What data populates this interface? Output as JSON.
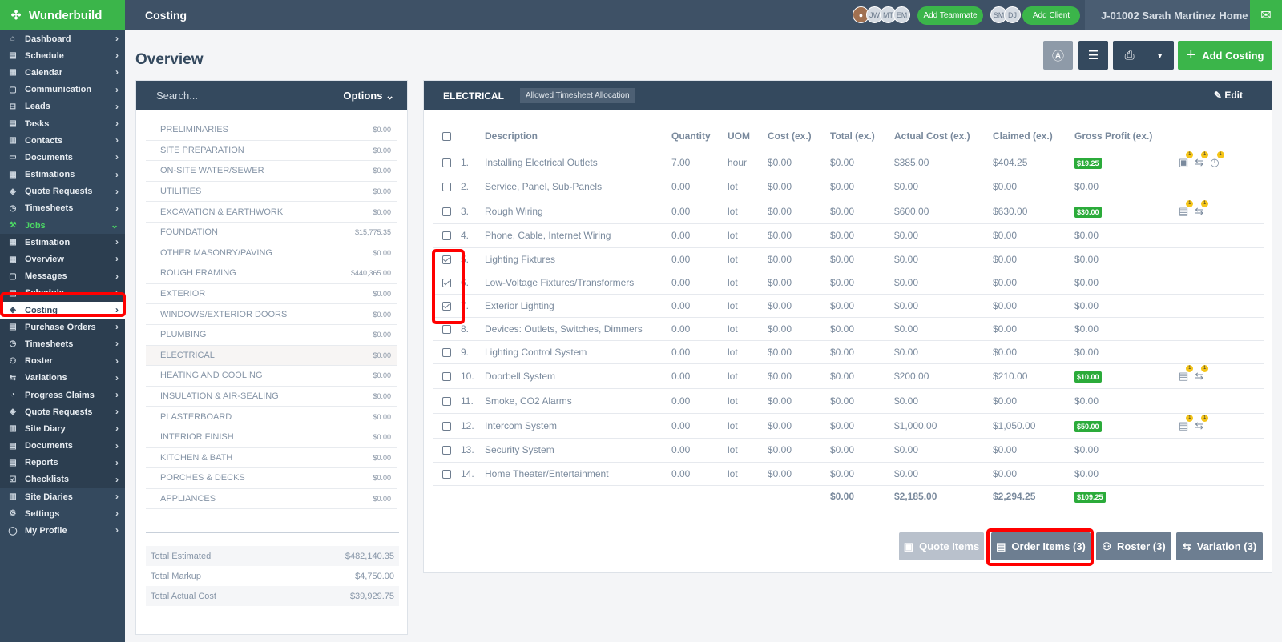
{
  "app": {
    "name": "Wunderbuild"
  },
  "topbar": {
    "title": "Costing",
    "avatars": [
      "JW",
      "MT",
      "EM"
    ],
    "add_teammate": "Add Teammate",
    "client_avatars": [
      "SM",
      "DJ"
    ],
    "add_client": "Add Client",
    "job_name": "J-01002 Sarah Martinez Home"
  },
  "sidebar": {
    "items": [
      {
        "label": "Dashboard",
        "icon": "home-icon"
      },
      {
        "label": "Schedule",
        "icon": "schedule-icon"
      },
      {
        "label": "Calendar",
        "icon": "calendar-icon"
      },
      {
        "label": "Communication",
        "icon": "chat-icon"
      },
      {
        "label": "Leads",
        "icon": "leads-icon"
      },
      {
        "label": "Tasks",
        "icon": "tasks-icon"
      },
      {
        "label": "Contacts",
        "icon": "contacts-icon"
      },
      {
        "label": "Documents",
        "icon": "folder-icon"
      },
      {
        "label": "Estimations",
        "icon": "estimations-icon"
      },
      {
        "label": "Quote Requests",
        "icon": "tag-icon"
      },
      {
        "label": "Timesheets",
        "icon": "clock-icon"
      },
      {
        "label": "Jobs",
        "icon": "hammer-icon"
      }
    ],
    "job_items": [
      {
        "label": "Estimation",
        "icon": "estimation-icon"
      },
      {
        "label": "Overview",
        "icon": "grid-icon"
      },
      {
        "label": "Messages",
        "icon": "message-icon"
      },
      {
        "label": "Schedule",
        "icon": "schedule-icon"
      },
      {
        "label": "Costing",
        "icon": "tag-icon"
      },
      {
        "label": "Purchase Orders",
        "icon": "purchase-icon"
      },
      {
        "label": "Timesheets",
        "icon": "clock-icon"
      },
      {
        "label": "Roster",
        "icon": "people-icon"
      },
      {
        "label": "Variations",
        "icon": "variation-icon"
      },
      {
        "label": "Progress Claims",
        "icon": "claims-icon"
      },
      {
        "label": "Quote Requests",
        "icon": "tag-icon"
      },
      {
        "label": "Site Diary",
        "icon": "diary-icon"
      },
      {
        "label": "Documents",
        "icon": "document-icon"
      },
      {
        "label": "Reports",
        "icon": "reports-icon"
      },
      {
        "label": "Checklists",
        "icon": "checklist-icon"
      }
    ],
    "bottom_items": [
      {
        "label": "Site Diaries",
        "icon": "diary-icon"
      },
      {
        "label": "Settings",
        "icon": "gear-icon"
      },
      {
        "label": "My Profile",
        "icon": "user-icon"
      }
    ]
  },
  "page": {
    "title": "Overview",
    "add_costing": "Add Costing"
  },
  "left_panel": {
    "search_placeholder": "Search...",
    "options_label": "Options",
    "categories": [
      {
        "name": "PRELIMINARIES",
        "amount": "$0.00"
      },
      {
        "name": "SITE PREPARATION",
        "amount": "$0.00"
      },
      {
        "name": "ON-SITE WATER/SEWER",
        "amount": "$0.00"
      },
      {
        "name": "UTILITIES",
        "amount": "$0.00"
      },
      {
        "name": "EXCAVATION & EARTHWORK",
        "amount": "$0.00"
      },
      {
        "name": "FOUNDATION",
        "amount": "$15,775.35"
      },
      {
        "name": "OTHER MASONRY/PAVING",
        "amount": "$0.00"
      },
      {
        "name": "ROUGH FRAMING",
        "amount": "$440,365.00"
      },
      {
        "name": "EXTERIOR",
        "amount": "$0.00"
      },
      {
        "name": "WINDOWS/EXTERIOR DOORS",
        "amount": "$0.00"
      },
      {
        "name": "PLUMBING",
        "amount": "$0.00"
      },
      {
        "name": "ELECTRICAL",
        "amount": "$0.00"
      },
      {
        "name": "HEATING AND COOLING",
        "amount": "$0.00"
      },
      {
        "name": "INSULATION & AIR-SEALING",
        "amount": "$0.00"
      },
      {
        "name": "PLASTERBOARD",
        "amount": "$0.00"
      },
      {
        "name": "INTERIOR FINISH",
        "amount": "$0.00"
      },
      {
        "name": "KITCHEN & BATH",
        "amount": "$0.00"
      },
      {
        "name": "PORCHES & DECKS",
        "amount": "$0.00"
      },
      {
        "name": "APPLIANCES",
        "amount": "$0.00"
      }
    ],
    "totals": [
      {
        "label": "Total Estimated",
        "value": "$482,140.35"
      },
      {
        "label": "Total Markup",
        "value": "$4,750.00"
      },
      {
        "label": "Total Actual Cost",
        "value": "$39,929.75"
      }
    ]
  },
  "section": {
    "name": "ELECTRICAL",
    "tag": "Allowed Timesheet Allocation",
    "edit_label": "Edit",
    "columns": [
      "Description",
      "Quantity",
      "UOM",
      "Cost (ex.)",
      "Total (ex.)",
      "Actual Cost (ex.)",
      "Claimed (ex.)",
      "Gross Profit (ex.)"
    ],
    "rows": [
      {
        "num": "1.",
        "desc": "Installing Electrical Outlets",
        "qty": "7.00",
        "uom": "hour",
        "cost": "$0.00",
        "total": "$0.00",
        "actual": "$385.00",
        "claimed": "$404.25",
        "gp": "$19.25",
        "gp_badge": true,
        "checked": false,
        "icons": [
          "purchase-order-icon",
          "variation-icon",
          "clock-icon"
        ]
      },
      {
        "num": "2.",
        "desc": "Service, Panel, Sub-Panels",
        "qty": "0.00",
        "uom": "lot",
        "cost": "$0.00",
        "total": "$0.00",
        "actual": "$0.00",
        "claimed": "$0.00",
        "gp": "$0.00",
        "gp_badge": false,
        "checked": false,
        "icons": []
      },
      {
        "num": "3.",
        "desc": "Rough Wiring",
        "qty": "0.00",
        "uom": "lot",
        "cost": "$0.00",
        "total": "$0.00",
        "actual": "$600.00",
        "claimed": "$630.00",
        "gp": "$30.00",
        "gp_badge": true,
        "checked": false,
        "icons": [
          "order-icon",
          "variation-icon"
        ]
      },
      {
        "num": "4.",
        "desc": "Phone, Cable, Internet Wiring",
        "qty": "0.00",
        "uom": "lot",
        "cost": "$0.00",
        "total": "$0.00",
        "actual": "$0.00",
        "claimed": "$0.00",
        "gp": "$0.00",
        "gp_badge": false,
        "checked": false,
        "icons": []
      },
      {
        "num": "5.",
        "desc": "Lighting Fixtures",
        "qty": "0.00",
        "uom": "lot",
        "cost": "$0.00",
        "total": "$0.00",
        "actual": "$0.00",
        "claimed": "$0.00",
        "gp": "$0.00",
        "gp_badge": false,
        "checked": true,
        "icons": []
      },
      {
        "num": "6.",
        "desc": "Low-Voltage Fixtures/Transformers",
        "qty": "0.00",
        "uom": "lot",
        "cost": "$0.00",
        "total": "$0.00",
        "actual": "$0.00",
        "claimed": "$0.00",
        "gp": "$0.00",
        "gp_badge": false,
        "checked": true,
        "icons": []
      },
      {
        "num": "7.",
        "desc": "Exterior Lighting",
        "qty": "0.00",
        "uom": "lot",
        "cost": "$0.00",
        "total": "$0.00",
        "actual": "$0.00",
        "claimed": "$0.00",
        "gp": "$0.00",
        "gp_badge": false,
        "checked": true,
        "icons": []
      },
      {
        "num": "8.",
        "desc": "Devices: Outlets, Switches, Dimmers",
        "qty": "0.00",
        "uom": "lot",
        "cost": "$0.00",
        "total": "$0.00",
        "actual": "$0.00",
        "claimed": "$0.00",
        "gp": "$0.00",
        "gp_badge": false,
        "checked": false,
        "icons": []
      },
      {
        "num": "9.",
        "desc": "Lighting Control System",
        "qty": "0.00",
        "uom": "lot",
        "cost": "$0.00",
        "total": "$0.00",
        "actual": "$0.00",
        "claimed": "$0.00",
        "gp": "$0.00",
        "gp_badge": false,
        "checked": false,
        "icons": []
      },
      {
        "num": "10.",
        "desc": "Doorbell System",
        "qty": "0.00",
        "uom": "lot",
        "cost": "$0.00",
        "total": "$0.00",
        "actual": "$200.00",
        "claimed": "$210.00",
        "gp": "$10.00",
        "gp_badge": true,
        "checked": false,
        "icons": [
          "order-icon",
          "variation-icon"
        ]
      },
      {
        "num": "11.",
        "desc": "Smoke, CO2 Alarms",
        "qty": "0.00",
        "uom": "lot",
        "cost": "$0.00",
        "total": "$0.00",
        "actual": "$0.00",
        "claimed": "$0.00",
        "gp": "$0.00",
        "gp_badge": false,
        "checked": false,
        "icons": []
      },
      {
        "num": "12.",
        "desc": "Intercom System",
        "qty": "0.00",
        "uom": "lot",
        "cost": "$0.00",
        "total": "$0.00",
        "actual": "$1,000.00",
        "claimed": "$1,050.00",
        "gp": "$50.00",
        "gp_badge": true,
        "checked": false,
        "icons": [
          "order-icon",
          "variation-icon"
        ]
      },
      {
        "num": "13.",
        "desc": "Security System",
        "qty": "0.00",
        "uom": "lot",
        "cost": "$0.00",
        "total": "$0.00",
        "actual": "$0.00",
        "claimed": "$0.00",
        "gp": "$0.00",
        "gp_badge": false,
        "checked": false,
        "icons": []
      },
      {
        "num": "14.",
        "desc": "Home Theater/Entertainment",
        "qty": "0.00",
        "uom": "lot",
        "cost": "$0.00",
        "total": "$0.00",
        "actual": "$0.00",
        "claimed": "$0.00",
        "gp": "$0.00",
        "gp_badge": false,
        "checked": false,
        "icons": []
      }
    ],
    "totals": {
      "total": "$0.00",
      "actual": "$2,185.00",
      "claimed": "$2,294.25",
      "gp": "$109.25"
    }
  },
  "footer_buttons": {
    "quote_items": "Quote Items",
    "order_items": "Order Items (3)",
    "roster": "Roster (3)",
    "variation": "Variation (3)"
  },
  "colors": {
    "brand": "#3bb54a",
    "navy": "#34495e",
    "highlight": "#ff0000"
  }
}
